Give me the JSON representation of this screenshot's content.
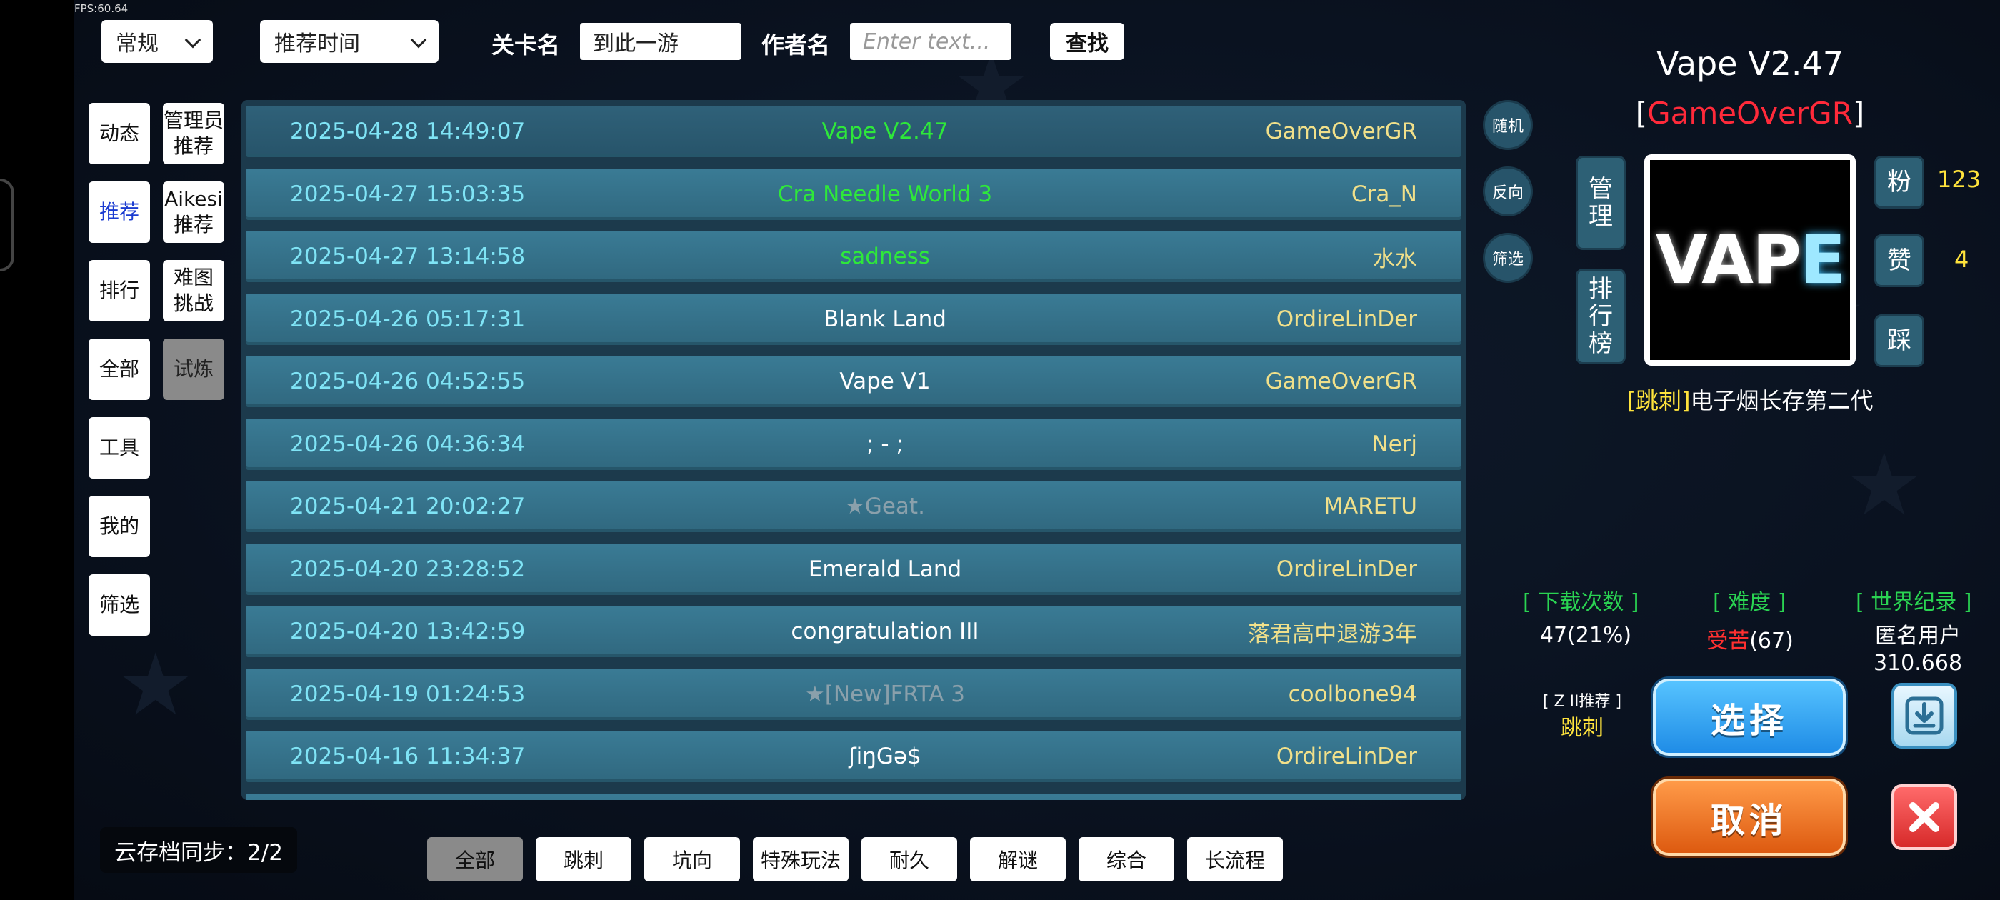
{
  "fps": "FPS:60.64",
  "top": {
    "mode_select": "常规",
    "sort_select": "推荐时间",
    "level_name_label": "关卡名",
    "level_name_value": "到此一游",
    "author_label": "作者名",
    "author_placeholder": "Enter text...",
    "search_label": "查找"
  },
  "tabs_left": [
    "动态",
    "推荐",
    "排行",
    "全部",
    "工具",
    "我的",
    "筛选"
  ],
  "tabs_right": [
    "管理员推荐",
    "Aikesi推荐",
    "难图挑战",
    "试炼"
  ],
  "tabs_right_lines": [
    [
      "管理员",
      "推荐"
    ],
    [
      "Aikesi",
      "推荐"
    ],
    [
      "难图",
      "挑战"
    ],
    [
      "试炼"
    ]
  ],
  "list": [
    {
      "date": "2025-04-28 14:49:07",
      "title": "Vape V2.47",
      "author": "GameOverGR",
      "title_color": "#2ee83a"
    },
    {
      "date": "2025-04-27 15:03:35",
      "title": "Cra Needle World 3",
      "author": "Cra_N",
      "title_color": "#2ee83a"
    },
    {
      "date": "2025-04-27 13:14:58",
      "title": "sadness",
      "author": "水水",
      "title_color": "#2ee83a"
    },
    {
      "date": "2025-04-26 05:17:31",
      "title": "Blank Land",
      "author": "OrdireLinDer",
      "title_color": "#ffffff"
    },
    {
      "date": "2025-04-26 04:52:55",
      "title": "Vape V1",
      "author": "GameOverGR",
      "title_color": "#ffffff"
    },
    {
      "date": "2025-04-26 04:36:34",
      "title": "; - ;",
      "author": "Nerj",
      "title_color": "#ffffff"
    },
    {
      "date": "2025-04-21 20:02:27",
      "title": "★Geat.",
      "author": "MARETU",
      "title_color": "#8aa0ab"
    },
    {
      "date": "2025-04-20 23:28:52",
      "title": "Emerald Land",
      "author": "OrdireLinDer",
      "title_color": "#ffffff"
    },
    {
      "date": "2025-04-20 13:42:59",
      "title": "congratulation III",
      "author": "落君高中退游3年",
      "title_color": "#ffffff"
    },
    {
      "date": "2025-04-19 01:24:53",
      "title": "★[New]FRTA 3",
      "author": "coolbone94",
      "title_color": "#8aa0ab"
    },
    {
      "date": "2025-04-16 11:34:37",
      "title": "ʃiŋGə$",
      "author": "OrdireLinDer",
      "title_color": "#ffffff"
    }
  ],
  "round_buttons": [
    "随机",
    "反向",
    "筛选"
  ],
  "detail": {
    "title": "Vape V2.47",
    "author": "GameOverGR",
    "manage_label": "管理",
    "rank_label": "排行榜",
    "thumb_text": "VAPE",
    "fans_label": "粉",
    "fans_count": "123",
    "like_label": "赞",
    "like_count": "4",
    "dislike_label": "踩",
    "desc_tag": "[跳刺]",
    "desc_text": "电子烟长存第二代",
    "downloads_head": "[ 下载次数 ]",
    "downloads_val": "47(21%)",
    "difficulty_head": "[ 难度 ]",
    "difficulty_word": "受苦",
    "difficulty_num": "(67)",
    "record_head": "[ 世界纪录 ]",
    "record_user": "匿名用户",
    "record_time": "310.668",
    "rec_small": "[ Z II推荐 ]",
    "rec_big": "跳刺",
    "select_label": "选择",
    "cancel_label": "取消"
  },
  "bottom": {
    "cloud_sync": "云存档同步：2/2",
    "categories": [
      "全部",
      "跳刺",
      "坑向",
      "特殊玩法",
      "耐久",
      "解谜",
      "综合",
      "长流程"
    ]
  }
}
